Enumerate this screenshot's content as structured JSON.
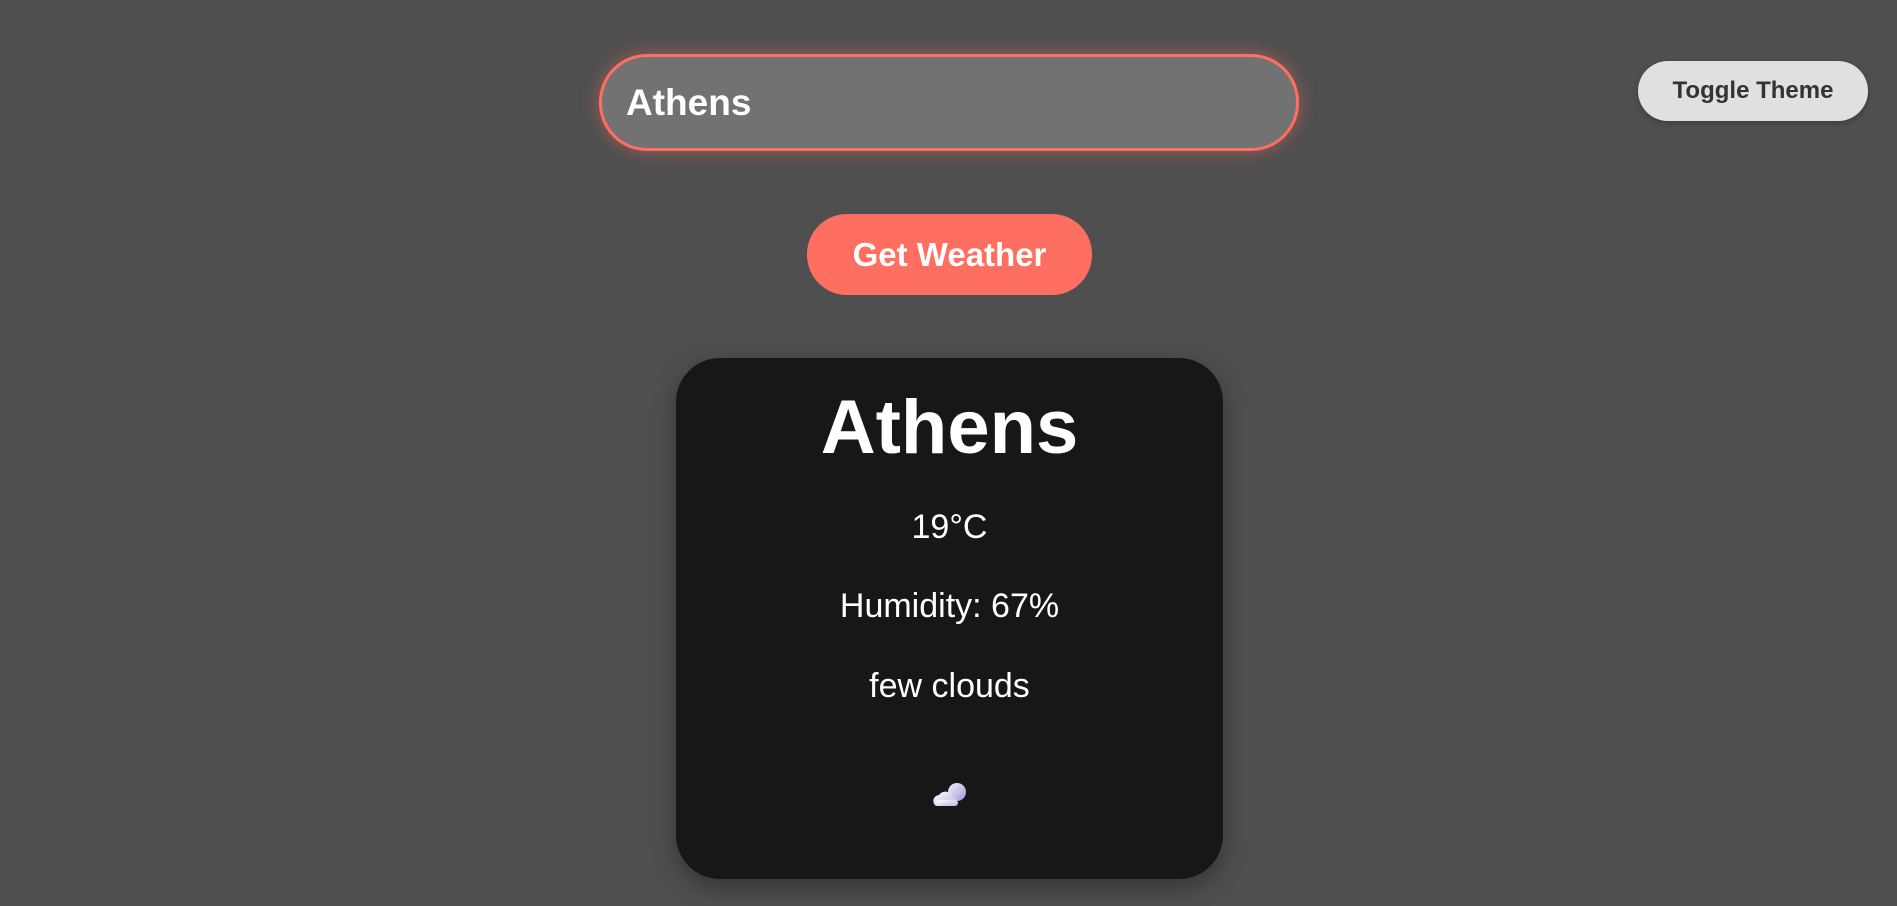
{
  "header": {
    "toggle_theme_label": "Toggle Theme"
  },
  "search": {
    "value": "Athens",
    "button_label": "Get Weather"
  },
  "weather": {
    "city": "Athens",
    "temperature": "19°C",
    "humidity": "Humidity: 67%",
    "description": "few clouds",
    "icon": "few-clouds-icon"
  },
  "colors": {
    "background": "#4f4f4f",
    "accent": "#ff6f61",
    "card": "#171717",
    "input_bg": "#727272",
    "toggle_bg": "#e0e0e0"
  }
}
